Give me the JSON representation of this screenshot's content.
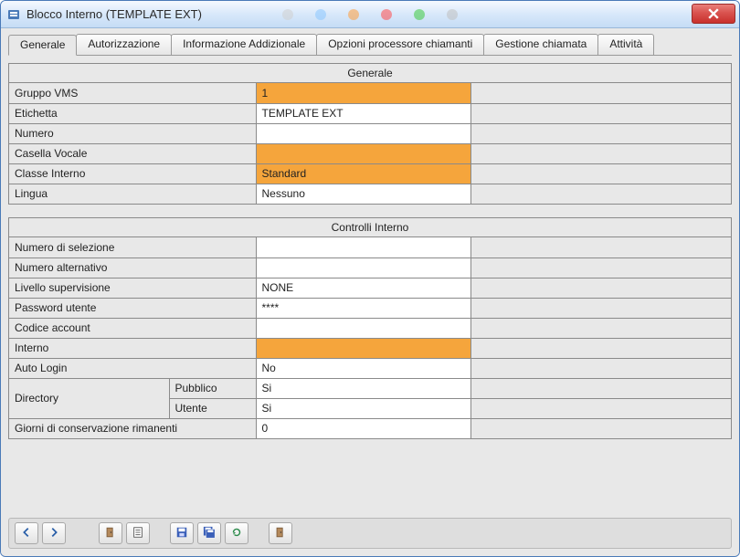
{
  "window": {
    "title": "Blocco Interno (TEMPLATE EXT)"
  },
  "tabs": [
    {
      "label": "Generale",
      "active": true
    },
    {
      "label": "Autorizzazione",
      "active": false
    },
    {
      "label": "Informazione Addizionale",
      "active": false
    },
    {
      "label": "Opzioni processore chiamanti",
      "active": false
    },
    {
      "label": "Gestione chiamata",
      "active": false
    },
    {
      "label": "Attività",
      "active": false
    }
  ],
  "sections": {
    "generale": {
      "title": "Generale",
      "rows": [
        {
          "label": "Gruppo VMS",
          "value": "1",
          "orange": true
        },
        {
          "label": "Etichetta",
          "value": "TEMPLATE EXT",
          "orange": false
        },
        {
          "label": "Numero",
          "value": "",
          "orange": false
        },
        {
          "label": "Casella Vocale",
          "value": "",
          "orange": true
        },
        {
          "label": "Classe Interno",
          "value": "Standard",
          "orange": true
        },
        {
          "label": "Lingua",
          "value": "Nessuno",
          "orange": false
        }
      ]
    },
    "controlli": {
      "title": "Controlli Interno",
      "rows_simple": [
        {
          "label": "Numero di selezione",
          "value": ""
        },
        {
          "label": "Numero alternativo",
          "value": ""
        },
        {
          "label": "Livello supervisione",
          "value": "NONE"
        },
        {
          "label": "Password utente",
          "value": "****"
        },
        {
          "label": "Codice account",
          "value": ""
        },
        {
          "label": "Interno",
          "value": "",
          "orange": true
        },
        {
          "label": "Auto Login",
          "value": "No"
        }
      ],
      "directory": {
        "label": "Directory",
        "sub": [
          {
            "label": "Pubblico",
            "value": "Si"
          },
          {
            "label": "Utente",
            "value": "Si"
          }
        ]
      },
      "last": {
        "label": "Giorni di conservazione rimanenti",
        "value": "0"
      }
    }
  },
  "toolbar": {
    "buttons": [
      {
        "name": "nav-back",
        "icon": "arrow-left"
      },
      {
        "name": "nav-forward",
        "icon": "arrow-right"
      },
      {
        "name": "gap"
      },
      {
        "name": "door-open",
        "icon": "door"
      },
      {
        "name": "document",
        "icon": "doc"
      },
      {
        "name": "gap-sm"
      },
      {
        "name": "save",
        "icon": "save"
      },
      {
        "name": "save-all",
        "icon": "save-all"
      },
      {
        "name": "refresh",
        "icon": "refresh"
      },
      {
        "name": "gap-sm"
      },
      {
        "name": "exit",
        "icon": "door"
      }
    ]
  }
}
